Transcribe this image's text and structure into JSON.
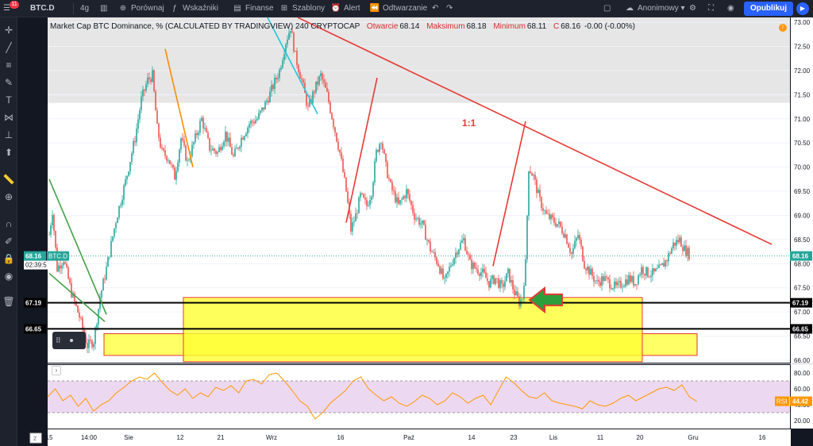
{
  "toolbar": {
    "symbol": "BTC.D",
    "interval": "4g",
    "compare": "Porównaj",
    "indicators": "Wskaźniki",
    "finance": "Finanse",
    "templates": "Szablony",
    "alert": "Alert",
    "replay": "Odtwarzanie",
    "account": "Anonimowy",
    "publish": "Opublikuj",
    "notification_count": "11"
  },
  "legend": {
    "title": "Market Cap BTC Dominance, % (CALCULATED BY TRADINGVIEW)",
    "interval": "240",
    "source": "CRYPTOCAP",
    "open_label": "Otwarcie",
    "open": "68.14",
    "high_label": "Maksimum",
    "high": "68.18",
    "low_label": "Minimum",
    "low": "68.11",
    "close_label": "C",
    "close": "68.16",
    "change": "-0.00 (-0.00%)"
  },
  "annotation_ratio": "1:1",
  "price_tags": {
    "current": "68.16",
    "current_symbol": "BTC.D",
    "countdown": "02:39:5",
    "support1": "67.19",
    "support2": "66.65",
    "rsi_label": "RSI",
    "rsi_value": "44.42"
  },
  "chart_data": {
    "type": "candlestick",
    "ylim": [
      65.95,
      73.1
    ],
    "y_ticks": [
      "73.00",
      "72.50",
      "72.00",
      "71.50",
      "71.00",
      "70.50",
      "70.00",
      "69.50",
      "69.00",
      "68.50",
      "68.00",
      "67.50",
      "67.00",
      "66.50",
      "66.00"
    ],
    "x_ticks": [
      "15",
      "14:00",
      "Sie",
      "12",
      "21",
      "Wrz",
      "16",
      "Paź",
      "14",
      "23",
      "Lis",
      "11",
      "20",
      "Gru",
      "16"
    ],
    "price_path": [
      [
        0,
        68.6
      ],
      [
        4,
        69.1
      ],
      [
        10,
        67.9
      ],
      [
        18,
        68.1
      ],
      [
        28,
        67.4
      ],
      [
        38,
        66.9
      ],
      [
        48,
        66.3
      ],
      [
        56,
        66.4
      ],
      [
        64,
        67.3
      ],
      [
        72,
        67.9
      ],
      [
        84,
        68.9
      ],
      [
        96,
        69.7
      ],
      [
        108,
        70.6
      ],
      [
        116,
        71.4
      ],
      [
        124,
        71.8
      ],
      [
        130,
        71.9
      ],
      [
        136,
        70.8
      ],
      [
        142,
        70.3
      ],
      [
        150,
        70.2
      ],
      [
        158,
        69.8
      ],
      [
        166,
        70.6
      ],
      [
        174,
        70.1
      ],
      [
        182,
        70.5
      ],
      [
        192,
        71.0
      ],
      [
        202,
        70.4
      ],
      [
        212,
        70.3
      ],
      [
        222,
        70.7
      ],
      [
        232,
        70.2
      ],
      [
        242,
        70.6
      ],
      [
        252,
        70.9
      ],
      [
        262,
        71.0
      ],
      [
        272,
        71.3
      ],
      [
        280,
        71.6
      ],
      [
        290,
        72.0
      ],
      [
        298,
        72.6
      ],
      [
        304,
        72.9
      ],
      [
        310,
        72.3
      ],
      [
        318,
        71.8
      ],
      [
        326,
        71.2
      ],
      [
        334,
        71.6
      ],
      [
        342,
        71.9
      ],
      [
        350,
        71.5
      ],
      [
        358,
        70.9
      ],
      [
        366,
        70.3
      ],
      [
        374,
        69.5
      ],
      [
        380,
        68.7
      ],
      [
        386,
        69.0
      ],
      [
        392,
        69.4
      ],
      [
        400,
        69.2
      ],
      [
        406,
        69.5
      ],
      [
        412,
        70.3
      ],
      [
        418,
        70.6
      ],
      [
        424,
        70.0
      ],
      [
        430,
        69.6
      ],
      [
        440,
        69.2
      ],
      [
        450,
        69.5
      ],
      [
        460,
        69.0
      ],
      [
        470,
        68.8
      ],
      [
        480,
        68.3
      ],
      [
        490,
        68.0
      ],
      [
        498,
        67.6
      ],
      [
        506,
        68.0
      ],
      [
        514,
        68.3
      ],
      [
        522,
        68.5
      ],
      [
        530,
        68.0
      ],
      [
        538,
        67.9
      ],
      [
        546,
        67.8
      ],
      [
        554,
        67.6
      ],
      [
        562,
        67.7
      ],
      [
        570,
        67.5
      ],
      [
        578,
        67.8
      ],
      [
        586,
        67.4
      ],
      [
        592,
        67.2
      ],
      [
        596,
        67.3
      ],
      [
        600,
        68.0
      ],
      [
        604,
        70.0
      ],
      [
        610,
        69.8
      ],
      [
        618,
        69.3
      ],
      [
        626,
        69.0
      ],
      [
        634,
        68.9
      ],
      [
        642,
        68.8
      ],
      [
        650,
        68.6
      ],
      [
        658,
        68.2
      ],
      [
        666,
        68.6
      ],
      [
        674,
        68.0
      ],
      [
        682,
        67.8
      ],
      [
        690,
        67.6
      ],
      [
        698,
        67.7
      ],
      [
        706,
        67.6
      ],
      [
        714,
        67.5
      ],
      [
        722,
        67.6
      ],
      [
        730,
        67.7
      ],
      [
        738,
        67.6
      ],
      [
        746,
        67.9
      ],
      [
        754,
        67.8
      ],
      [
        762,
        67.8
      ],
      [
        770,
        67.9
      ],
      [
        778,
        68.1
      ],
      [
        786,
        68.4
      ],
      [
        794,
        68.5
      ],
      [
        800,
        68.3
      ],
      [
        806,
        68.2
      ]
    ],
    "support_levels": [
      67.19,
      66.65
    ],
    "rsi": {
      "ylim": [
        10,
        90
      ],
      "ticks": [
        "80.00",
        "60.00",
        "40.00",
        "20.00"
      ],
      "bands": [
        70,
        30
      ],
      "values": [
        50,
        60,
        45,
        52,
        38,
        48,
        32,
        40,
        45,
        55,
        62,
        70,
        75,
        72,
        80,
        68,
        58,
        52,
        60,
        48,
        55,
        50,
        62,
        58,
        64,
        55,
        70,
        72,
        66,
        78,
        80,
        70,
        58,
        45,
        38,
        22,
        30,
        42,
        50,
        58,
        70,
        75,
        60,
        52,
        45,
        50,
        42,
        38,
        44,
        52,
        48,
        40,
        45,
        55,
        50,
        42,
        48,
        52,
        40,
        58,
        75,
        68,
        58,
        50,
        48,
        55,
        45,
        42,
        40,
        38,
        35,
        45,
        40,
        38,
        42,
        48,
        52,
        45,
        50,
        55,
        60,
        62,
        58,
        65,
        50,
        44
      ]
    }
  }
}
